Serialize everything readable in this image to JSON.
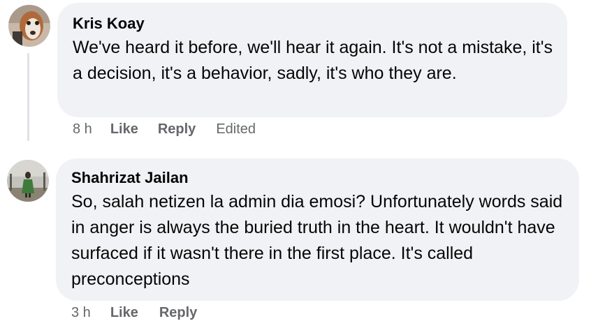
{
  "comments": [
    {
      "author": "Kris Koay",
      "text": "We've heard it before, we'll hear it again. It's not a mistake, it's a decision, it's a behavior, sadly, it's who they are.",
      "time": "8 h",
      "like_label": "Like",
      "reply_label": "Reply",
      "edited_label": "Edited"
    },
    {
      "author": "Shahrizat Jailan",
      "text": "So, salah netizen la admin dia emosi? Unfortunately words said in anger is always the buried truth in the heart. It wouldn't have surfaced if it wasn't there in the first place. It's called preconceptions",
      "time": "3 h",
      "like_label": "Like",
      "reply_label": "Reply"
    }
  ]
}
